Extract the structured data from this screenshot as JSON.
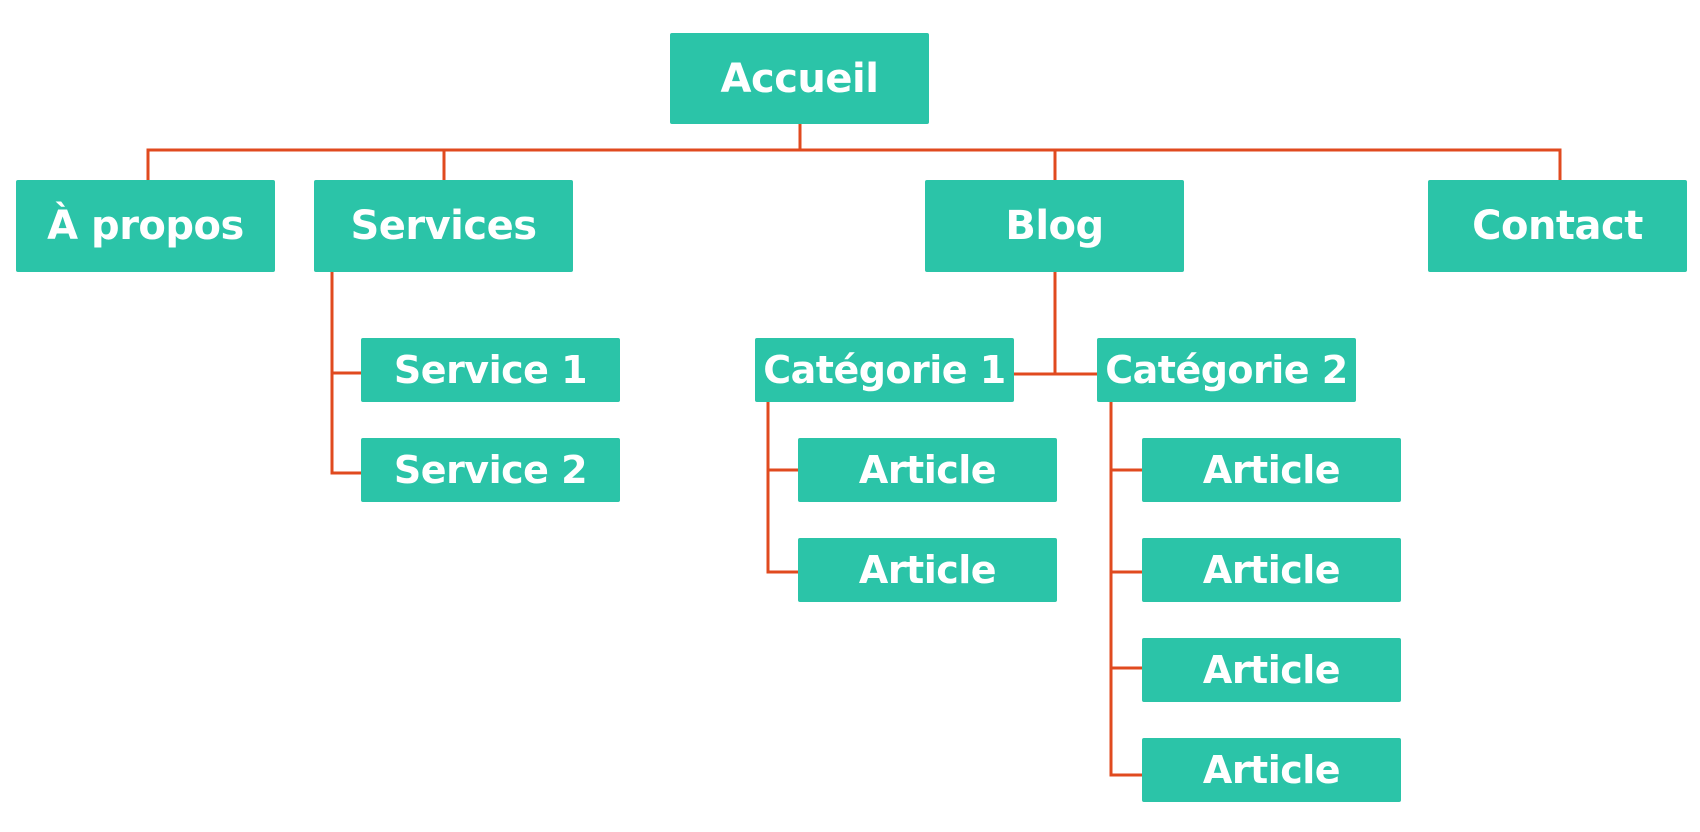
{
  "colors": {
    "node_fill": "#2BC4A8",
    "node_text": "#FFFFFF",
    "connector": "#E04A1F",
    "background": "#FFFFFF"
  },
  "sitemap": {
    "root": {
      "label": "Accueil"
    },
    "sections": {
      "apropos": {
        "label": "À propos"
      },
      "services": {
        "label": "Services",
        "children": [
          {
            "label": "Service 1"
          },
          {
            "label": "Service 2"
          }
        ]
      },
      "blog": {
        "label": "Blog",
        "categories": [
          {
            "label": "Catégorie 1",
            "articles": [
              {
                "label": "Article"
              },
              {
                "label": "Article"
              }
            ]
          },
          {
            "label": "Catégorie 2",
            "articles": [
              {
                "label": "Article"
              },
              {
                "label": "Article"
              },
              {
                "label": "Article"
              },
              {
                "label": "Article"
              }
            ]
          }
        ]
      },
      "contact": {
        "label": "Contact"
      }
    }
  }
}
